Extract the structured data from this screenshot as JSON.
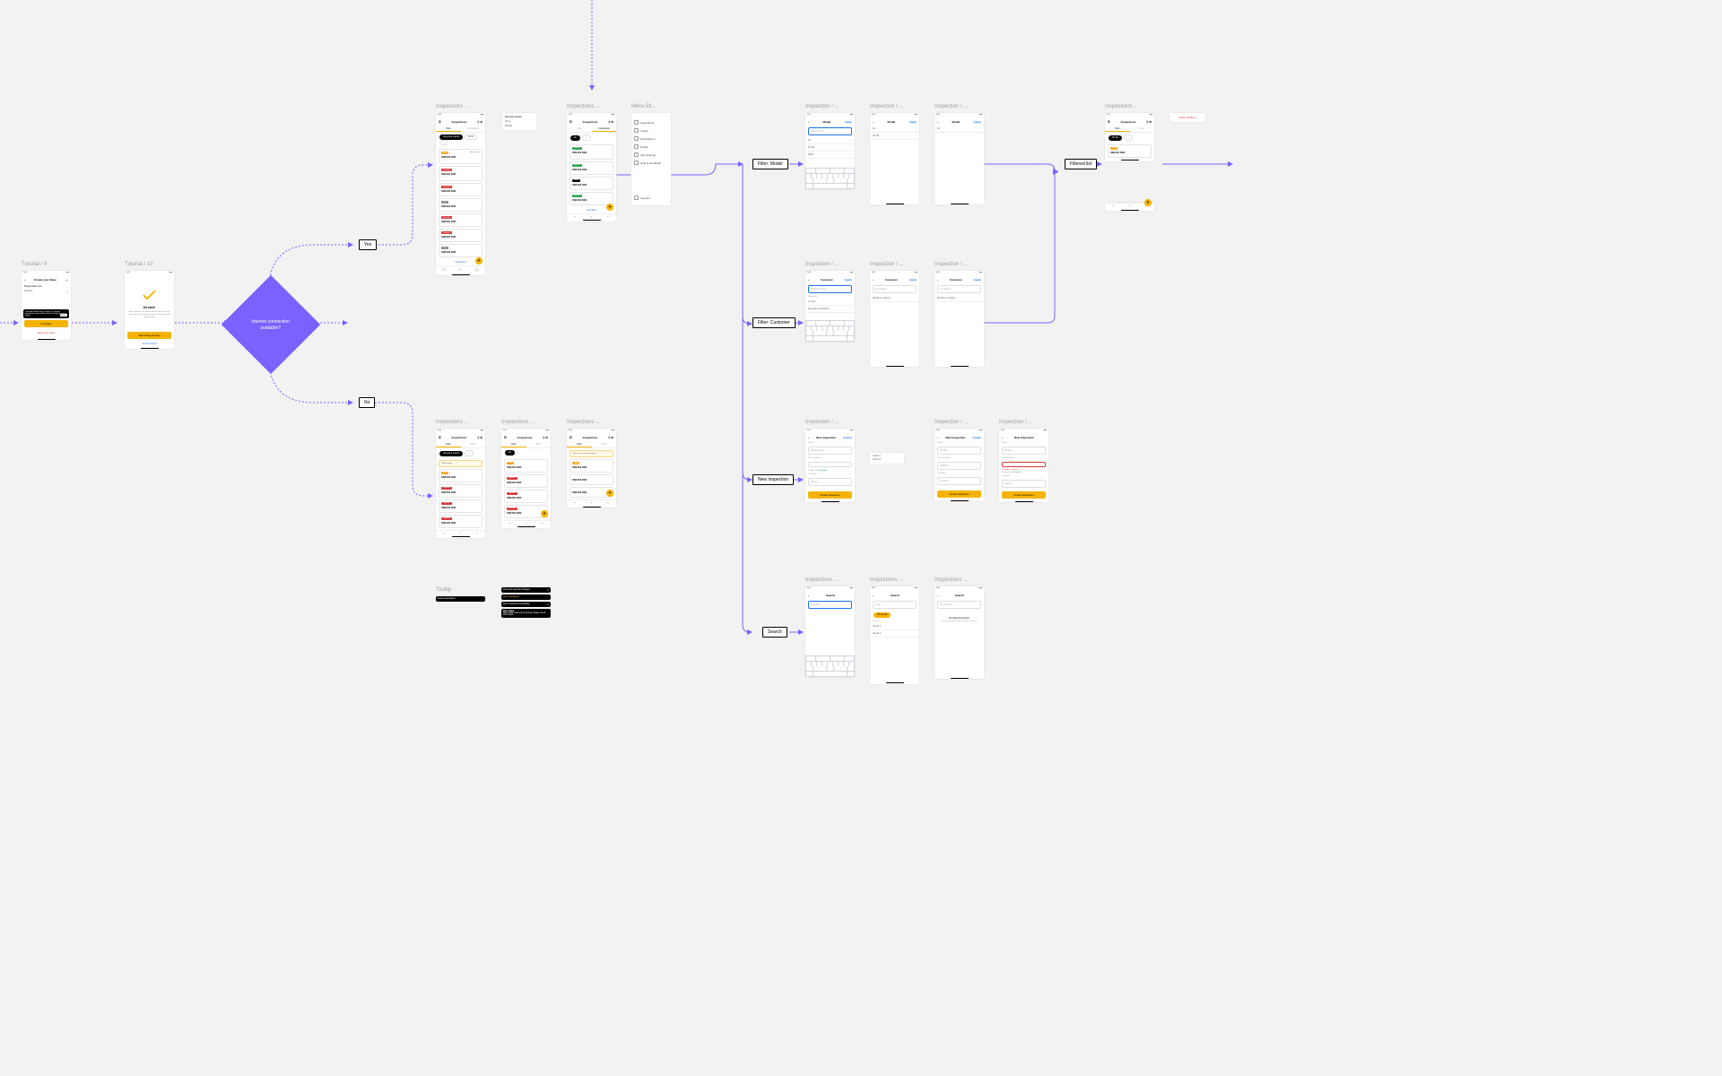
{
  "decision": {
    "text": "Internet connection available?"
  },
  "labels": {
    "yes": "Yes",
    "no": "No",
    "filterModel": "Filter: Model",
    "filterCustomer": "Filter: Customer",
    "newInspection": "New Inspection",
    "search": "Search",
    "filteredList": "Filtered list"
  },
  "titles": {
    "tut9": "Tutorial / 9",
    "tut10": "Tutorial / 10",
    "insp": "Inspections ...",
    "menu": "Menu Dr...",
    "tooltip": "Tooltip",
    "inspSlash": "Inspection / ..."
  },
  "common": {
    "time": "9:41",
    "inspections": "Inspections",
    "todo": "Todo",
    "done": "Done",
    "completed": "Completed",
    "loadMore": "Load More",
    "since": "Since 1 day",
    "serial": "SN1234 D4K",
    "unsynced": "Unsynced reports",
    "model": "Model",
    "customer": "Customer",
    "home": "Home",
    "draft": "Draft",
    "profile": "Profile",
    "offline": "Offline mode"
  },
  "tut9": {
    "header": "Create your Repo",
    "project": "Project Name too",
    "evidence": "Evidence",
    "tooltip": "Complete below and a copy of a system-generated report will be sent to the device once online",
    "next": "Next",
    "complete": "Complete",
    "report": "Report an issue"
  },
  "tut10": {
    "allDone": "All done!",
    "desc": "My inspection has been saved locally. You can now sync your inspection once back online and continue later",
    "start": "Start Using the App",
    "tutorial": "Do the tutorial"
  },
  "menu": {
    "items": [
      "Inspections",
      "Invites",
      "Notifications",
      "Profile",
      "App Settings",
      "Help & Feedback",
      "Log Out"
    ]
  },
  "tooltipCards": {
    "t1": "Feature description",
    "t2": "There are unsynced changes",
    "t3": "Sync in progress",
    "t4": "Sync completed successfully",
    "t5": "Sync failed",
    "t5b": "Some data could not be synced. Please check and resync."
  },
  "filterModel": {
    "title": "Model",
    "search": "Search input",
    "items": [
      "All",
      "D6 XE",
      "950M"
    ]
  },
  "filterCustomer": {
    "title": "Customer",
    "search": "Customer name",
    "suggested": "Suggested",
    "results": [
      "Acorda",
      "Machinery Partner",
      "Abergale Contractors"
    ]
  },
  "newInsp": {
    "title": "New Inspection",
    "cancel": "Cancel",
    "create": "Create",
    "model": "Model",
    "serial": "Serial Number",
    "productLink": "Product Link",
    "available": "Available",
    "customerLbl": "Customer",
    "createBtn": "Create Inspection",
    "errMsg": "This field is required"
  },
  "search": {
    "title": "Search",
    "placeholder": "Q  Search",
    "recent": "Recent",
    "noResults": "No Results Found",
    "noResultsSub": "Please try again with a different keyword"
  },
  "filtered": {
    "chip": "D6 XE",
    "clearAll": "Clear all filters"
  },
  "navSmall": {
    "recentlyViewed": "Recently Viewed",
    "home": "Home",
    "module": "Module"
  },
  "offline": {
    "banner": "Offline mode",
    "txt": "There are unsaved changes"
  },
  "searchChip": "D6 XE 24a"
}
